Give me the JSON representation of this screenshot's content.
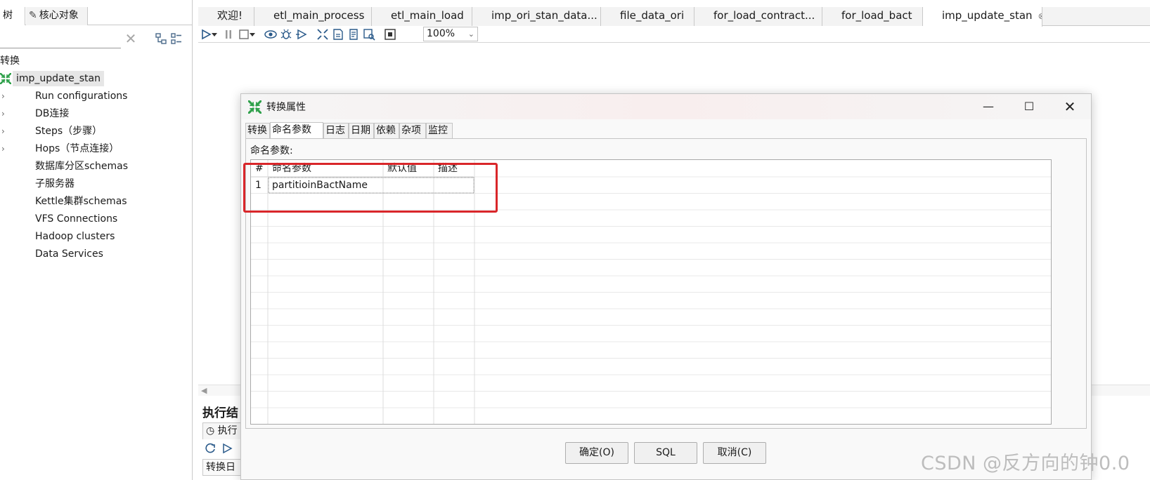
{
  "left_panel": {
    "tabs": [
      "树",
      "核心对象"
    ],
    "filter_placeholder": "",
    "tree_root": "转换",
    "transformation": "imp_update_stan",
    "items": [
      {
        "label": "Run configurations",
        "expandable": true
      },
      {
        "label": "DB连接",
        "expandable": true
      },
      {
        "label": "Steps（步骤）",
        "expandable": true
      },
      {
        "label": "Hops（节点连接）",
        "expandable": true
      },
      {
        "label": "数据库分区schemas",
        "expandable": false
      },
      {
        "label": "子服务器",
        "expandable": false
      },
      {
        "label": "Kettle集群schemas",
        "expandable": false
      },
      {
        "label": "VFS Connections",
        "expandable": false
      },
      {
        "label": "Hadoop clusters",
        "expandable": false
      },
      {
        "label": "Data Services",
        "expandable": false
      }
    ]
  },
  "editor": {
    "tabs": [
      {
        "label": "欢迎!",
        "icon": "welcome-icon"
      },
      {
        "label": "etl_main_process",
        "icon": "job-icon"
      },
      {
        "label": "etl_main_load",
        "icon": "job-icon"
      },
      {
        "label": "imp_ori_stan_data...",
        "icon": "job-icon"
      },
      {
        "label": "file_data_ori",
        "icon": "job-icon"
      },
      {
        "label": "for_load_contract...",
        "icon": "job-icon"
      },
      {
        "label": "for_load_bact",
        "icon": "job-icon"
      },
      {
        "label": "imp_update_stan",
        "icon": "transformation-icon",
        "active": true
      }
    ],
    "close_glyph": "⊗",
    "zoom": "100%",
    "execution_title": "执行结",
    "execution_tab": "执行",
    "execution_subtab": "转换日"
  },
  "dialog": {
    "title": "转换属性",
    "tabs": [
      "转换",
      "命名参数",
      "日志",
      "日期",
      "依赖",
      "杂项",
      "监控"
    ],
    "active_tab": 1,
    "params_label": "命名参数:",
    "grid": {
      "columns": [
        "#",
        "命名参数",
        "默认值",
        "描述"
      ],
      "rows": [
        [
          "1",
          "partitioinBactName",
          "",
          ""
        ]
      ]
    },
    "buttons": {
      "ok": "确定(O)",
      "sql": "SQL",
      "cancel": "取消(C)"
    }
  },
  "watermark": "CSDN @反方向的钟0.0",
  "colors": {
    "highlight_box": "#d9262a",
    "job_icon": "#f0a030",
    "transformation_icon": "#2ea04a"
  }
}
